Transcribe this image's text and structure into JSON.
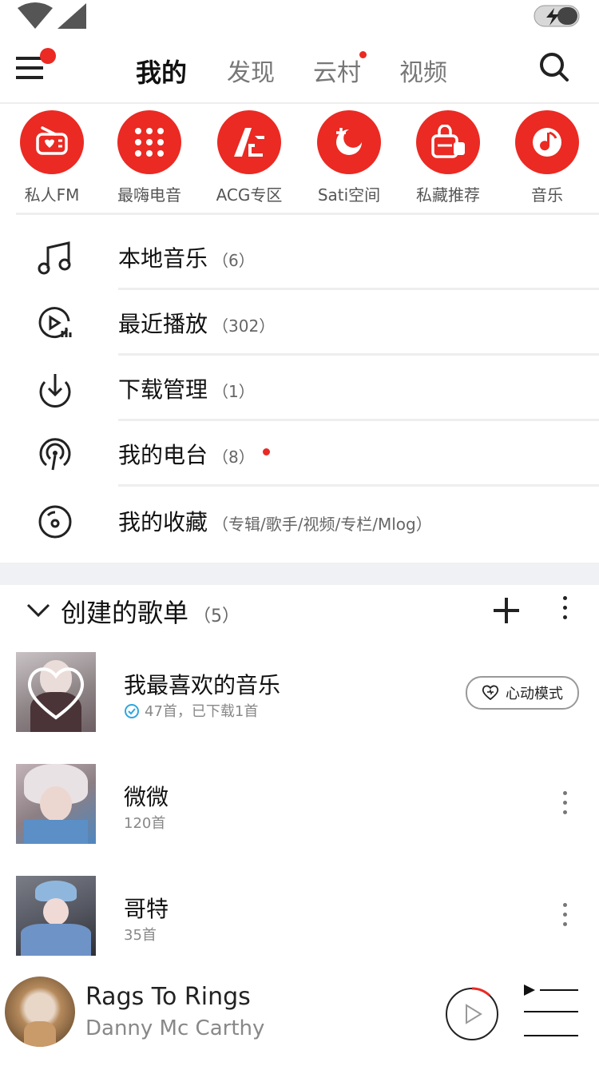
{
  "colors": {
    "accent": "#ea2a23",
    "text": "#111111",
    "muted": "#888888",
    "divider": "#eeeeee",
    "verified": "#2ea7e0"
  },
  "nav": {
    "tabs": [
      "我的",
      "发现",
      "云村",
      "视频"
    ],
    "active_tab": "我的",
    "icons": {
      "menu": "hamburger-menu-icon",
      "search": "search-icon"
    }
  },
  "quick_access": [
    {
      "label": "私人FM",
      "icon": "radio-icon"
    },
    {
      "label": "最嗨电音",
      "icon": "dots-grid-icon"
    },
    {
      "label": "ACG专区",
      "icon": "acg-logo-icon"
    },
    {
      "label": "Sati空间",
      "icon": "moon-plus-icon"
    },
    {
      "label": "私藏推荐",
      "icon": "gift-bag-icon"
    },
    {
      "label": "音乐",
      "icon": "music-note-icon"
    }
  ],
  "menu": [
    {
      "label": "本地音乐",
      "count": "（6）",
      "icon": "music-note-icon"
    },
    {
      "label": "最近播放",
      "count": "（302）",
      "icon": "recent-play-icon"
    },
    {
      "label": "下载管理",
      "count": "（1）",
      "icon": "download-icon"
    },
    {
      "label": "我的电台",
      "count": "（8）",
      "icon": "podcast-icon",
      "badge": true
    },
    {
      "label": "我的收藏",
      "count": "（专辑/歌手/视频/专栏/Mlog）",
      "icon": "disc-icon"
    }
  ],
  "playlists_section": {
    "title": "创建的歌单",
    "count": "（5）"
  },
  "playlists": [
    {
      "title": "我最喜欢的音乐",
      "subtitle": "47首，已下载1首",
      "action_label": "心动模式",
      "verified": true
    },
    {
      "title": "微微",
      "subtitle": "120首"
    },
    {
      "title": "哥特",
      "subtitle": "35首"
    }
  ],
  "now_playing": {
    "title": "Rags To Rings",
    "artist": "Danny Mc Carthy",
    "progress": 0.12
  }
}
